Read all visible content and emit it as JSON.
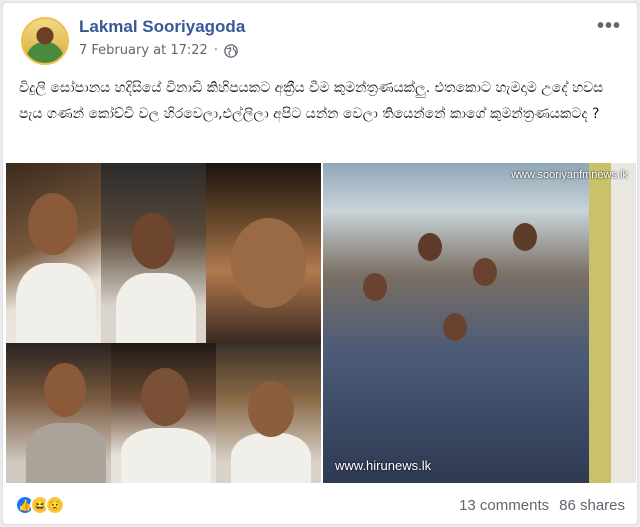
{
  "post": {
    "author": "Lakmal Sooriyagoda",
    "timestamp": "7 February at 17:22",
    "privacy_icon": "globe-icon",
    "more_label": "•••",
    "text": "විදුලි සෝපානය හදිසියේ විනාඩි කිහිපයකට අක්‍රීය වීම කුමන්ත්‍රණයක්ලු. එතකොට හැමදාම උදේ හවස පැය ගණන් කෝච්චි වල හිරවෙලා,එල්ලිලා අපිට යන්න වෙලා තියෙන්නේ කාගේ කුමන්ත්‍රණයකටද ?"
  },
  "photos": {
    "watermark_top": "www.sooriyanfmnews.lk",
    "watermark_bottom": "www.hirunews.lk"
  },
  "footer": {
    "reactions": [
      "like-icon",
      "haha-icon",
      "sad-icon"
    ],
    "comments": "13 comments",
    "shares": "86 shares"
  },
  "colors": {
    "author_link": "#385898",
    "meta_text": "#606770",
    "like_blue": "#1877f2"
  }
}
